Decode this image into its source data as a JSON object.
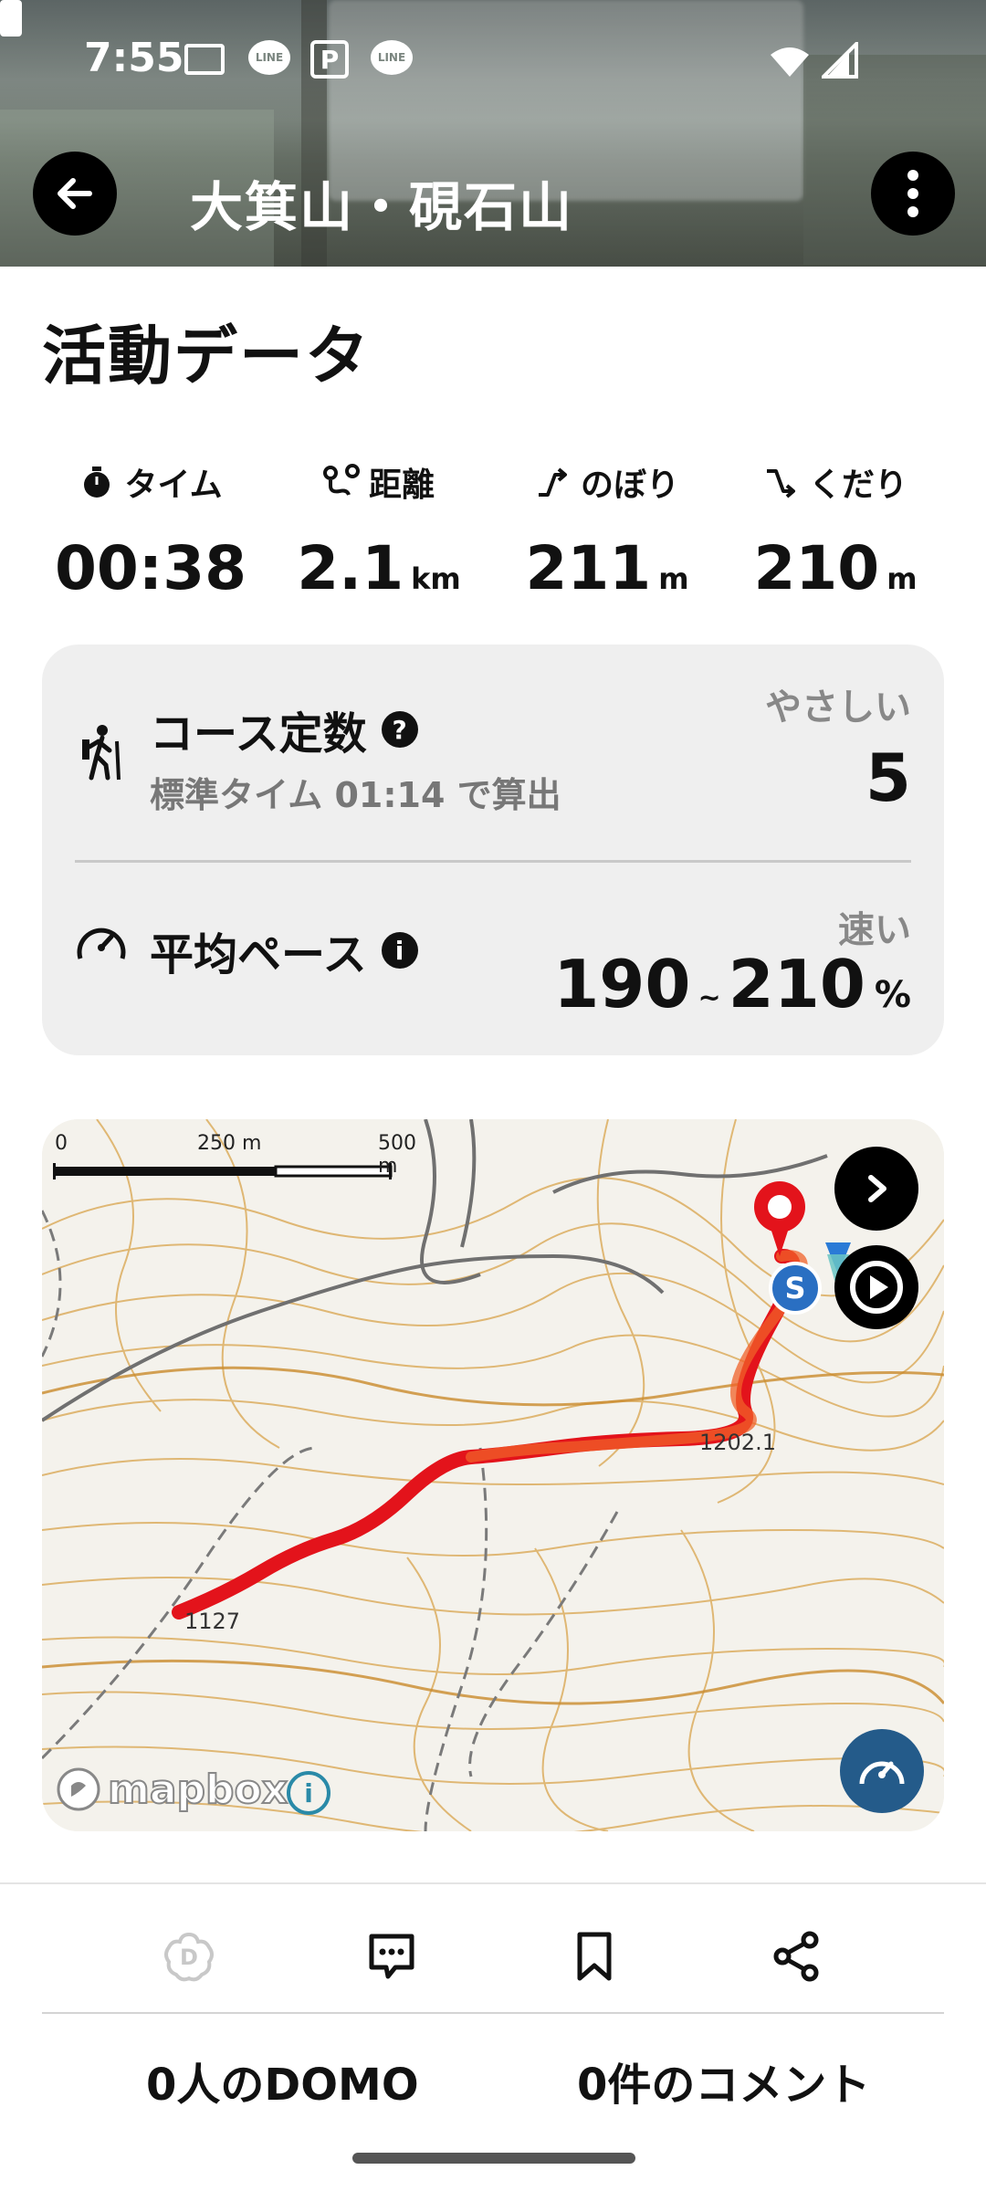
{
  "status_bar": {
    "time": "7:55",
    "line_label": "LINE",
    "p_label": "P"
  },
  "header": {
    "title": "大箕山・硯石山"
  },
  "activity": {
    "section_title": "活動データ",
    "stats": [
      {
        "label": "タイム",
        "value": "00:38",
        "unit": ""
      },
      {
        "label": "距離",
        "value": "2.1",
        "unit": "km"
      },
      {
        "label": "のぼり",
        "value": "211",
        "unit": "m"
      },
      {
        "label": "くだり",
        "value": "210",
        "unit": "m"
      }
    ]
  },
  "course": {
    "title": "コース定数",
    "help": "?",
    "subtitle": "標準タイム 01:14 で算出",
    "level_label": "やさしい",
    "value": "5"
  },
  "pace": {
    "title": "平均ペース",
    "info": "i",
    "speed_label": "速い",
    "min": "190",
    "tilde": "~",
    "max": "210",
    "unit": "%"
  },
  "map": {
    "scale_0": "0",
    "scale_250": "250 m",
    "scale_500": "500 m",
    "elev_1": "1202.1",
    "elev_2": "1127",
    "start_marker": "S",
    "attribution": "mapbox",
    "attribution_info": "i"
  },
  "bottom": {
    "domo_text": "0人のDOMO",
    "comments_text": "0件のコメント"
  }
}
